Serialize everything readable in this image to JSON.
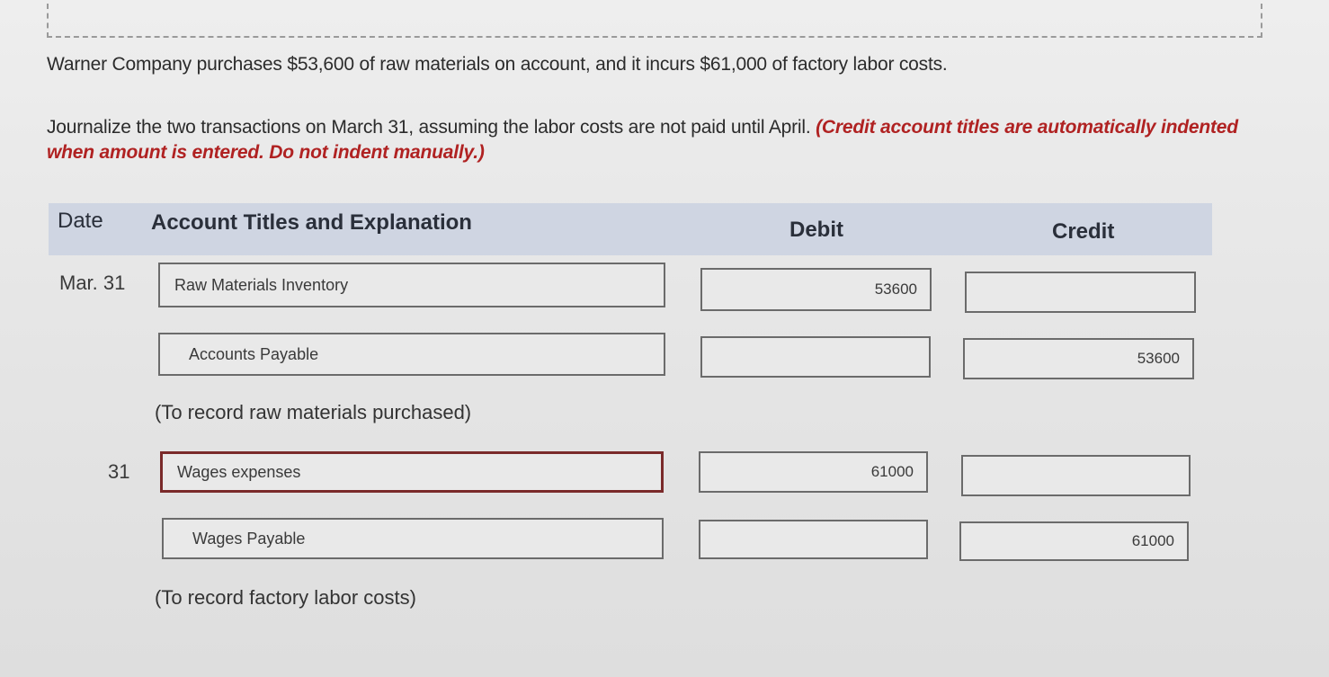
{
  "question": {
    "prompt": "Warner Company purchases $53,600 of raw materials on account, and it incurs $61,000 of factory labor costs.",
    "instruction_main": "Journalize the two transactions on March 31, assuming the labor costs are not paid until April. ",
    "instruction_note": "(Credit account titles are automatically indented when amount is entered. Do not indent manually.)"
  },
  "table": {
    "headers": {
      "date": "Date",
      "account": "Account Titles and Explanation",
      "debit": "Debit",
      "credit": "Credit"
    },
    "entries": [
      {
        "date": "Mar. 31",
        "lines": [
          {
            "account": "Raw Materials Inventory",
            "debit": "53600",
            "credit": ""
          },
          {
            "account": "Accounts Payable",
            "debit": "",
            "credit": "53600"
          }
        ],
        "explanation": "(To record raw materials purchased)"
      },
      {
        "date": "31",
        "lines": [
          {
            "account": "Wages expenses",
            "debit": "61000",
            "credit": ""
          },
          {
            "account": "Wages Payable",
            "debit": "",
            "credit": "61000"
          }
        ],
        "explanation": "(To record factory labor costs)"
      }
    ]
  }
}
